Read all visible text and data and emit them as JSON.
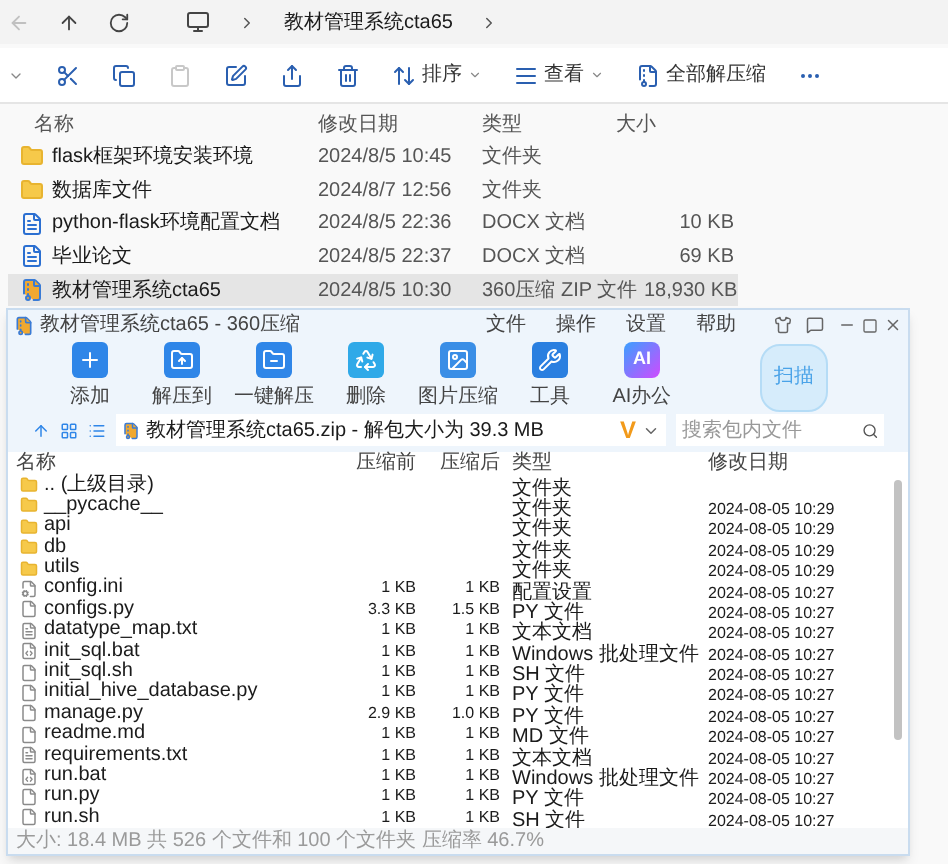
{
  "explorer": {
    "nav": [
      {
        "kind": "back",
        "disabled": true
      },
      {
        "kind": "up",
        "disabled": false
      },
      {
        "kind": "refresh",
        "disabled": false
      }
    ],
    "breadcrumb": [
      "教材管理系统cta65"
    ],
    "toolbar": [
      {
        "kind": "cut",
        "disabled": false
      },
      {
        "kind": "copy",
        "disabled": false
      },
      {
        "kind": "paste",
        "disabled": true
      },
      {
        "kind": "rename",
        "disabled": false
      },
      {
        "kind": "share",
        "disabled": false
      },
      {
        "kind": "delete",
        "disabled": false
      },
      {
        "kind": "sort",
        "label": "排序",
        "disabled": false
      },
      {
        "kind": "view",
        "label": "查看",
        "disabled": false
      },
      {
        "kind": "extract",
        "label": "全部解压缩",
        "disabled": false
      },
      {
        "kind": "more",
        "disabled": false
      }
    ],
    "columns": [
      "名称",
      "修改日期",
      "类型",
      "大小"
    ],
    "rows": [
      {
        "kind": "folder",
        "name": "flask框架环境安装环境",
        "date": "2024/8/5 10:45",
        "type": "文件夹",
        "selected": false
      },
      {
        "kind": "folder",
        "name": "数据库文件",
        "date": "2024/8/7 12:56",
        "type": "文件夹",
        "selected": false
      },
      {
        "kind": "docx",
        "name": "python-flask环境配置文档",
        "date": "2024/8/5 22:36",
        "type": "DOCX 文档",
        "size": "10 KB",
        "selected": false
      },
      {
        "kind": "docx",
        "name": "毕业论文",
        "date": "2024/8/5 22:37",
        "type": "DOCX 文档",
        "size": "69 KB",
        "selected": false
      },
      {
        "kind": "zip",
        "name": "教材管理系统cta65",
        "date": "2024/8/5 10:30",
        "type": "360压缩 ZIP 文件",
        "size": "18,930 KB",
        "selected": true
      }
    ]
  },
  "archive": {
    "title": "教材管理系统cta65 - 360压缩",
    "menu": [
      "文件",
      "操作",
      "设置",
      "帮助"
    ],
    "tools": [
      {
        "kind": "add",
        "label": "添加"
      },
      {
        "kind": "extract_to",
        "label": "解压到"
      },
      {
        "kind": "quick_extract",
        "label": "一键解压"
      },
      {
        "kind": "delete",
        "label": "删除"
      },
      {
        "kind": "image",
        "label": "图片压缩"
      },
      {
        "kind": "tools",
        "label": "工具"
      },
      {
        "kind": "ai",
        "label": "AI办公",
        "badge": "AI"
      }
    ],
    "scan": "扫描",
    "path": "教材管理系统cta65.zip - 解包大小为 39.3 MB",
    "logo": "V",
    "search": {
      "placeholder": "搜索包内文件"
    },
    "columns": [
      "名称",
      "压缩前",
      "压缩后",
      "类型",
      "修改日期"
    ],
    "files": [
      {
        "kind": "folder",
        "name": ".. (上级目录)",
        "type": "文件夹"
      },
      {
        "kind": "folder",
        "name": "__pycache__",
        "type": "文件夹",
        "date": "2024-08-05 10:29"
      },
      {
        "kind": "folder",
        "name": "api",
        "type": "文件夹",
        "date": "2024-08-05 10:29"
      },
      {
        "kind": "folder",
        "name": "db",
        "type": "文件夹",
        "date": "2024-08-05 10:29"
      },
      {
        "kind": "folder",
        "name": "utils",
        "type": "文件夹",
        "date": "2024-08-05 10:29"
      },
      {
        "kind": "settings",
        "name": "config.ini",
        "before": "1 KB",
        "after": "1 KB",
        "type": "配置设置",
        "date": "2024-08-05 10:27"
      },
      {
        "kind": "document",
        "name": "configs.py",
        "before": "3.3 KB",
        "after": "1.5 KB",
        "type": "PY 文件",
        "date": "2024-08-05 10:27"
      },
      {
        "kind": "text",
        "name": "datatype_map.txt",
        "before": "1 KB",
        "after": "1 KB",
        "type": "文本文档",
        "date": "2024-08-05 10:27"
      },
      {
        "kind": "script",
        "name": "init_sql.bat",
        "before": "1 KB",
        "after": "1 KB",
        "type": "Windows 批处理文件",
        "date": "2024-08-05 10:27"
      },
      {
        "kind": "document",
        "name": "init_sql.sh",
        "before": "1 KB",
        "after": "1 KB",
        "type": "SH 文件",
        "date": "2024-08-05 10:27"
      },
      {
        "kind": "document",
        "name": "initial_hive_database.py",
        "before": "1 KB",
        "after": "1 KB",
        "type": "PY 文件",
        "date": "2024-08-05 10:27"
      },
      {
        "kind": "document",
        "name": "manage.py",
        "before": "2.9 KB",
        "after": "1.0 KB",
        "type": "PY 文件",
        "date": "2024-08-05 10:27"
      },
      {
        "kind": "document",
        "name": "readme.md",
        "before": "1 KB",
        "after": "1 KB",
        "type": "MD 文件",
        "date": "2024-08-05 10:27"
      },
      {
        "kind": "text",
        "name": "requirements.txt",
        "before": "1 KB",
        "after": "1 KB",
        "type": "文本文档",
        "date": "2024-08-05 10:27"
      },
      {
        "kind": "script",
        "name": "run.bat",
        "before": "1 KB",
        "after": "1 KB",
        "type": "Windows 批处理文件",
        "date": "2024-08-05 10:27"
      },
      {
        "kind": "document",
        "name": "run.py",
        "before": "1 KB",
        "after": "1 KB",
        "type": "PY 文件",
        "date": "2024-08-05 10:27"
      },
      {
        "kind": "document",
        "name": "run.sh",
        "before": "1 KB",
        "after": "1 KB",
        "type": "SH 文件",
        "date": "2024-08-05 10:27"
      }
    ],
    "status": "大小: 18.4 MB 共 526 个文件和 100 个文件夹 压缩率 46.7%"
  }
}
